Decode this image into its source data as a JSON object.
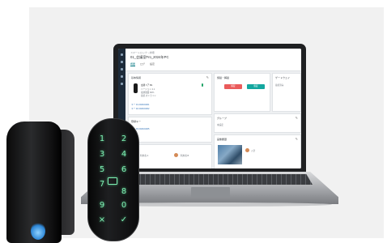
{
  "app": {
    "breadcrumb": "スマートロック › 詳細",
    "title": "01_会議室Fro_2024年PC",
    "tabs": [
      "概要",
      "ログ",
      "設定"
    ]
  },
  "cards": {
    "device": {
      "title": "基本情報",
      "name": "玄関ドア B1",
      "lines": [
        "バージョン 2.1",
        "電池残量 82%",
        "接続 オンライン"
      ]
    },
    "status": {
      "title": "施錠・解錠",
      "unlock_label": "解錠",
      "lock_label": "施錠"
    },
    "gateway": {
      "title": "ゲートウェイ",
      "line": "接続済み"
    },
    "keys": {
      "title": "登録キー",
      "items": [
        "キー 01 2024/04/01",
        "キー 02 2024/04/02",
        "キー 03 2024/04/05"
      ]
    },
    "group": {
      "title": "グループ",
      "line": "未設定"
    },
    "camera": {
      "title": "画像履歴",
      "badge": "入室"
    },
    "users": {
      "label1": "利用者 A",
      "label2": "利用者 B"
    }
  },
  "keypad": {
    "keys": [
      "1",
      "2",
      "3",
      "4",
      "5",
      "6",
      "7",
      "8",
      "9",
      "0",
      "×",
      "✓"
    ],
    "glow_color": "#7ff0b4"
  },
  "colors": {
    "lock_led": "#2d86d6",
    "unlock_button": "#ea5b5b",
    "lock_button": "#13a79f"
  }
}
